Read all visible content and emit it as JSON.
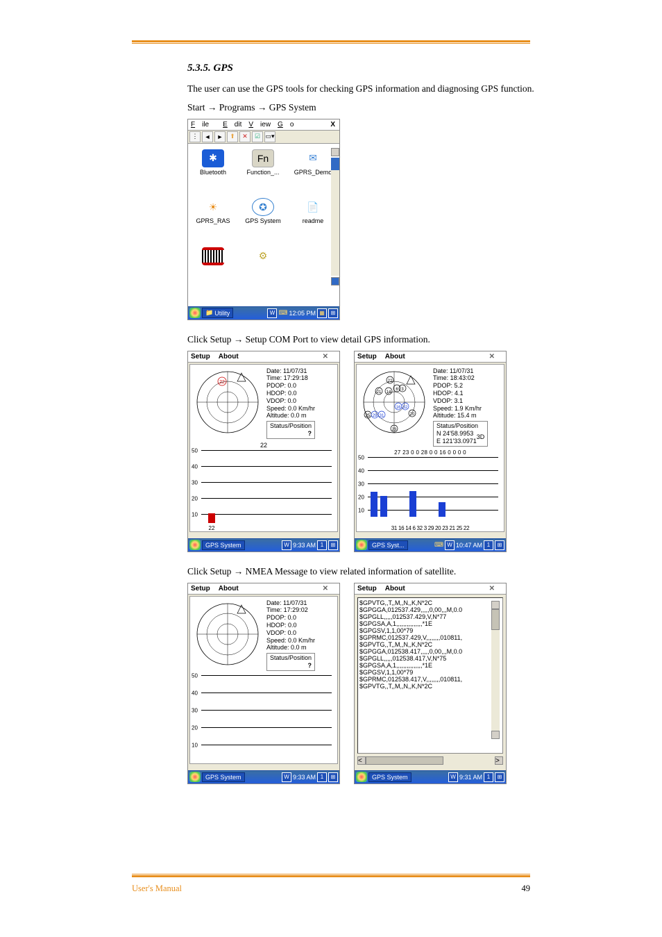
{
  "heading": "5.3.5.    GPS",
  "intro": "The user can use the GPS tools for checking GPS information and diagnosing GPS function.",
  "step1_prefix": "Start",
  "step1_mid": "Programs",
  "step1_suffix": "GPS System",
  "arrow": "→",
  "filebrowser": {
    "menu": {
      "file": "File",
      "edit": "Edit",
      "view": "View",
      "go": "Go",
      "close": "X"
    },
    "items": [
      {
        "label": "Bluetooth",
        "name": "bluetooth-icon",
        "emoji": "✱",
        "bg": "#1a5cd6",
        "color": "#fff"
      },
      {
        "label": "Function_...",
        "name": "function-icon",
        "emoji": "Fn",
        "bg": "#d9d6c6",
        "color": "#000"
      },
      {
        "label": "GPRS_Demo",
        "name": "gprs-demo-icon",
        "emoji": "✉",
        "bg": "#fff",
        "color": "#3a83d6"
      },
      {
        "label": "GPRS_RAS",
        "name": "gprs-ras-icon",
        "emoji": "◉",
        "bg": "#fff",
        "color": "#e88f1e"
      },
      {
        "label": "GPS System",
        "name": "gps-system-icon",
        "emoji": "✪",
        "bg": "#fff",
        "color": "#3580cf"
      },
      {
        "label": "readme",
        "name": "readme-icon",
        "emoji": "📄",
        "bg": "#fff",
        "color": "#333"
      }
    ],
    "barcode_item": "",
    "taskbar": {
      "title": "Utility",
      "time": "12:05 PM"
    }
  },
  "step2_prefix": "Click Setup",
  "step2_suffix": "Setup COM Port to view detail GPS information.",
  "gps1": {
    "menu": {
      "setup": "Setup",
      "about": "About"
    },
    "stats": {
      "date": "Date: 11/07/31",
      "time": "Time: 17:29:18",
      "pdop": "PDOP: 0.0",
      "hdop": "HDOP: 0.0",
      "vdop": "VDOP: 0.0",
      "speed": "Speed: 0.0 Km/hr",
      "alt": "Altitude: 0.0 m"
    },
    "status_label": "Status/Position",
    "status_value": "?",
    "sat_top": "22",
    "sat_bottom": "22",
    "taskbar": {
      "title": "GPS System",
      "time": "9:33 AM"
    }
  },
  "gps2": {
    "menu": {
      "setup": "Setup",
      "about": "About"
    },
    "stats": {
      "date": "Date: 11/07/31",
      "time": "Time: 18:43:02",
      "pdop": "PDOP: 5.2",
      "hdop": "HDOP: 4.1",
      "vdop": "VDOP: 3.1",
      "speed": "Speed: 1.9 Km/hr",
      "alt": "Altitude: 15.4 m"
    },
    "status_label": "Status/Position",
    "status_value1": "N 24'58.9953",
    "status_value2": "E 121'33.0971",
    "status_mode": "3D",
    "sat_top": "27 23 0 0 28 0 0 16 0 0 0 0",
    "sat_bottom": "31 16 14 6 32 3 29 20 23 21 25 22",
    "taskbar": {
      "title": "GPS Syst...",
      "time": "10:47 AM"
    }
  },
  "gps3": {
    "stats": {
      "date": "Date: 11/07/31",
      "time": "Time: 17:29:02",
      "pdop": "PDOP: 0.0",
      "hdop": "HDOP: 0.0",
      "vdop": "VDOP: 0.0",
      "speed": "Speed: 0.0 Km/hr",
      "alt": "Altitude: 0.0 m"
    },
    "status_label": "Status/Position",
    "status_value": "?",
    "taskbar": {
      "title": "GPS System",
      "time": "9:33 AM"
    }
  },
  "gps4": {
    "nmea_lines": [
      "$GPVTG,,T,,M,,N,,K,N*2C",
      "$GPGGA,012537.429,,,,,0,00,,,M,0.0",
      "$GPGLL,,,,,012537.429,V,N*77",
      "$GPGSA,A,1,,,,,,,,,,,,,,,*1E",
      "$GPGSV,1,1,00*79",
      "$GPRMC,012537.429,V,,,,,,,,010811,",
      "$GPVTG,,T,,M,,N,,K,N*2C",
      "$GPGGA,012538.417,,,,,0,00,,,M,0.0",
      "$GPGLL,,,,,012538.417,V,N*75",
      "$GPGSA,A,1,,,,,,,,,,,,,,,*1E",
      "$GPGSV,1,1,00*79",
      "$GPRMC,012538.417,V,,,,,,,,010811,",
      "$GPVTG,,T,,M,,N,,K,N*2C"
    ],
    "taskbar": {
      "title": "GPS System",
      "time": "9:31 AM"
    }
  },
  "step3_prefix": "Click Setup",
  "step3_suffix": "NMEA Message to view related information of satellite.",
  "chart_data": {
    "type": "bar",
    "ylim": [
      0,
      50
    ],
    "yticks": [
      10,
      20,
      30,
      40,
      50
    ],
    "win1": {
      "categories": [
        "22"
      ],
      "values": [
        10
      ],
      "color": "#c00"
    },
    "win2": {
      "categories": [
        "31",
        "16",
        "14",
        "6",
        "32",
        "3",
        "29",
        "20",
        "23",
        "21",
        "25",
        "22"
      ],
      "values": [
        27,
        23,
        0,
        0,
        28,
        0,
        0,
        16,
        0,
        0,
        0,
        0
      ],
      "color": "#1a3fd4"
    }
  },
  "footer": {
    "left": "User's Manual",
    "page": "49"
  }
}
